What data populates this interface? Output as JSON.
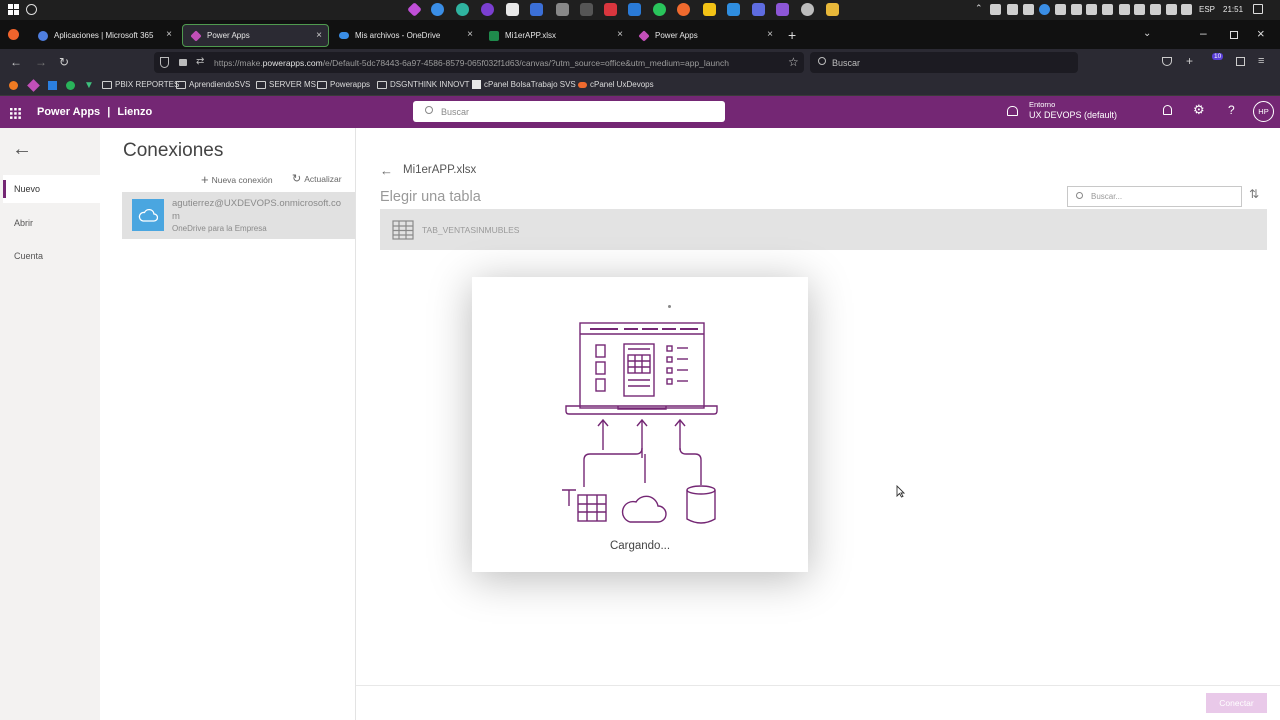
{
  "taskbar": {
    "language": "ESP",
    "time": "21:51"
  },
  "browser": {
    "tabs": [
      {
        "label": "Aplicaciones | Microsoft 365",
        "active": false
      },
      {
        "label": "Power Apps",
        "active": true
      },
      {
        "label": "Mis archivos - OneDrive",
        "active": false
      },
      {
        "label": "Mi1erAPP.xlsx",
        "active": false
      },
      {
        "label": "Power Apps",
        "active": false
      }
    ],
    "url_prefix": "https://make.",
    "url_domain": "powerapps.com",
    "url_rest": "/e/Default-5dc78443-6a97-4586-8579-065f032f1d63/canvas/?utm_source=office&utm_medium=app_launch",
    "search_placeholder": "Buscar",
    "bookmarks": [
      "PBIX REPORTES",
      "AprendiendoSVS",
      "SERVER MS",
      "Powerapps",
      "DSGNTHINK INNOVT",
      "cPanel BolsaTrabajo SVS",
      "cPanel UxDevops"
    ],
    "extension_badge": "10"
  },
  "header": {
    "app_name": "Power Apps",
    "separator": "|",
    "section": "Lienzo",
    "search_placeholder": "Buscar",
    "env_label": "Entorno",
    "env_value": "UX DEVOPS (default)",
    "avatar_initials": "HP"
  },
  "leftnav": {
    "items": [
      "Nuevo",
      "Abrir",
      "Cuenta"
    ],
    "active": "Nuevo"
  },
  "connections": {
    "title": "Conexiones",
    "new_label": "Nueva conexión",
    "refresh_label": "Actualizar",
    "item": {
      "email": "agutierrez@UXDEVOPS.onmicrosoft.com",
      "service": "OneDrive para la Empresa"
    }
  },
  "file_panel": {
    "file_name": "Mi1erAPP.xlsx",
    "title": "Elegir una tabla",
    "search_placeholder": "Buscar...",
    "tables": [
      "TAB_VENTASINMUBLES"
    ],
    "connect_label": "Conectar"
  },
  "dialog": {
    "loading_text": "Cargando...",
    "illustration_color": "#742774"
  },
  "colors": {
    "brand": "#742774",
    "tab_border": "#4f9a4f"
  }
}
